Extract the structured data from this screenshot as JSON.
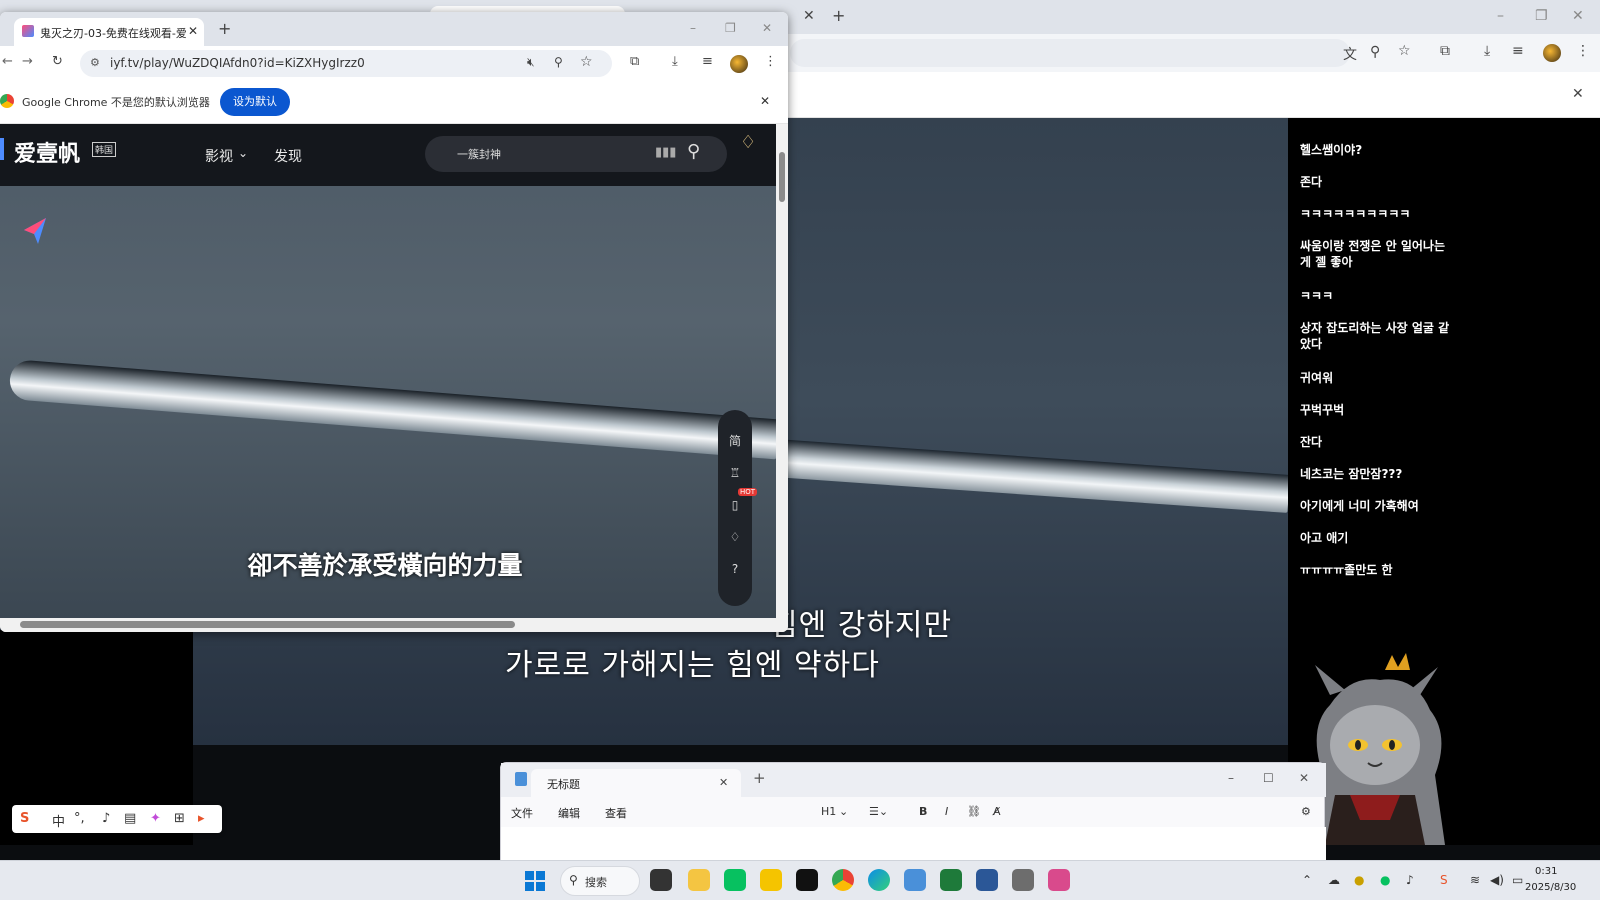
{
  "bg_window": {
    "korean_subtitle_1": "힘엔 강하지만",
    "korean_subtitle_2": "가로로 가해지는 힘엔 약하다",
    "chat": [
      "헬스쌤이야?",
      "존다",
      "ㅋㅋㅋㅋㅋㅋㅋㅋㅋㅋ",
      "싸움이랑 전쟁은 안 일어나는 게 젤 좋아",
      "ㅋㅋㅋ",
      "상자 잡도리하는 사장 얼굴 같았다",
      "귀여워",
      "꾸벅꾸벅",
      "잔다",
      "네츠코는 잠만잠???",
      "아기에게 너미 가혹해여",
      "아고 애기",
      "ㅠㅠㅠㅠ졸만도 한"
    ]
  },
  "front_window": {
    "tab_title": "鬼灭之刃-03-免费在线观看-爱",
    "url": "iyf.tv/play/WuZDQIAfdn0?id=KiZXHygIrzz0",
    "info_text": "Google Chrome 不是您的默认浏览器",
    "set_default_label": "设为默认",
    "site": {
      "logo": "爱壹帆",
      "region_badge": "韩国",
      "nav_1": "影视",
      "nav_2": "发现",
      "search_placeholder": "一簇封神",
      "side_toolbar": [
        "简",
        "HOT"
      ]
    },
    "chinese_subtitle": "卻不善於承受橫向的力量"
  },
  "notepad": {
    "title": "无标题",
    "menu": [
      "文件",
      "编辑",
      "查看"
    ],
    "heading_label": "H1"
  },
  "ime": {
    "mode": "中"
  },
  "taskbar": {
    "search_label": "搜索",
    "time": "0:31",
    "date": "2025/8/30"
  },
  "colors": {
    "chrome_blue": "#0b57d0",
    "taskbar": "#e6e9ef"
  }
}
